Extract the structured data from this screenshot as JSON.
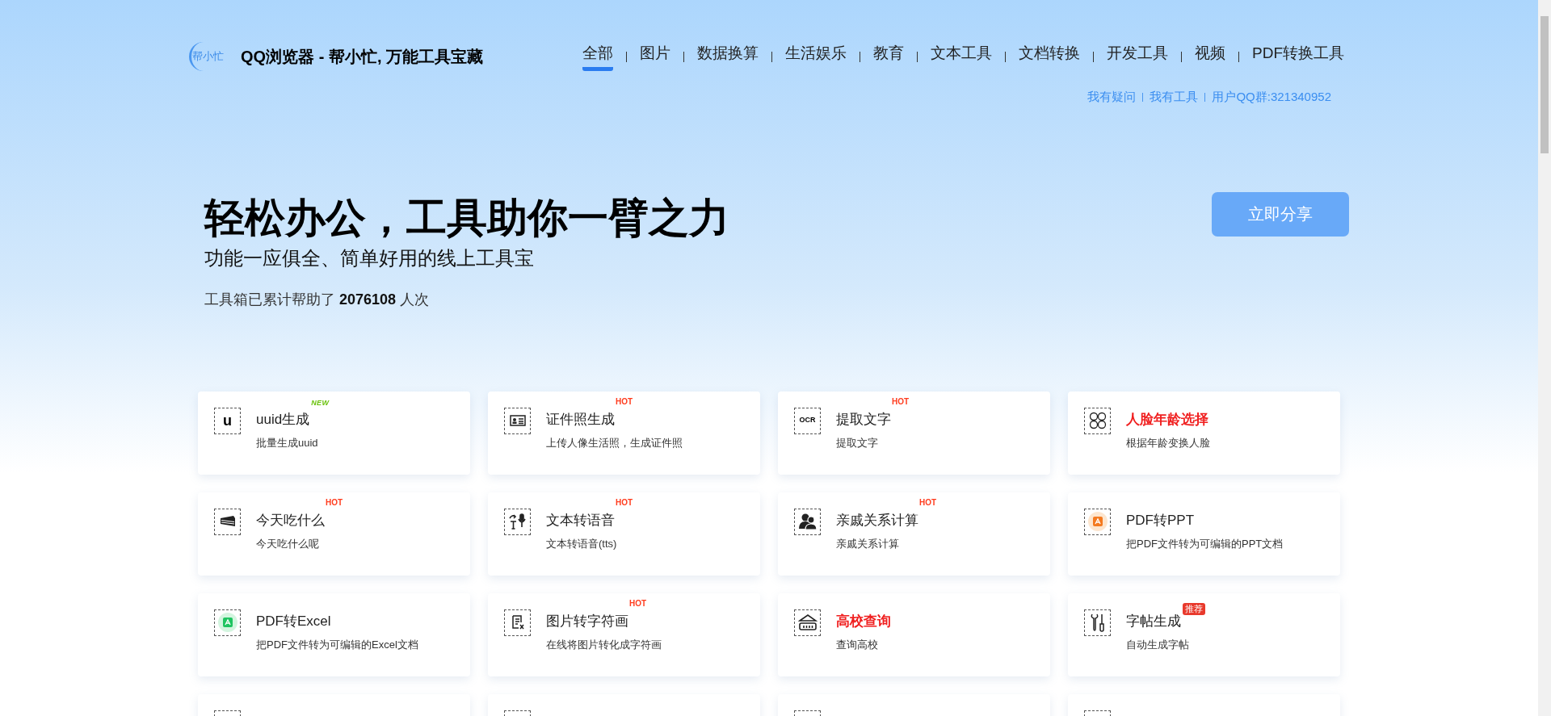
{
  "header": {
    "logo_text": "帮小忙",
    "title": "QQ浏览器 - 帮小忙, 万能工具宝藏",
    "nav": [
      {
        "label": "全部",
        "selected": true
      },
      {
        "label": "图片",
        "selected": false
      },
      {
        "label": "数据换算",
        "selected": false
      },
      {
        "label": "生活娱乐",
        "selected": false
      },
      {
        "label": "教育",
        "selected": false
      },
      {
        "label": "文本工具",
        "selected": false
      },
      {
        "label": "文档转换",
        "selected": false
      },
      {
        "label": "开发工具",
        "selected": false
      },
      {
        "label": "视频",
        "selected": false
      },
      {
        "label": "PDF转换工具",
        "selected": false
      }
    ],
    "links": [
      "我有疑问",
      "我有工具",
      "用户QQ群:321340952"
    ]
  },
  "hero": {
    "heading": "轻松办公，工具助你一臂之力",
    "subtitle": "功能一应俱全、简单好用的线上工具宝",
    "counter_prefix": "工具箱已累计帮助了",
    "counter_value": "2076108",
    "counter_suffix": "人次",
    "share_button": "立即分享"
  },
  "tools": [
    {
      "kind": "letter",
      "icon_text": "u",
      "title": "uuid生成",
      "highlight": false,
      "badge": {
        "kind": "new",
        "text": "NEW"
      },
      "description": "批量生成uuid"
    },
    {
      "kind": "id-card",
      "title": "证件照生成",
      "highlight": false,
      "badge": {
        "kind": "hot",
        "text": "HOT"
      },
      "description": "上传人像生活照，生成证件照"
    },
    {
      "kind": "letter",
      "icon_text": "OCR",
      "title": "提取文字",
      "highlight": false,
      "badge": {
        "kind": "hot",
        "text": "HOT"
      },
      "description": "提取文字"
    },
    {
      "kind": "faces",
      "title": "人脸年龄选择",
      "highlight": true,
      "description": "根据年龄变换人脸"
    },
    {
      "kind": "cake",
      "title": "今天吃什么",
      "highlight": false,
      "badge": {
        "kind": "hot",
        "text": "HOT"
      },
      "description": "今天吃什么呢"
    },
    {
      "kind": "speech",
      "title": "文本转语音",
      "highlight": false,
      "badge": {
        "kind": "hot",
        "text": "HOT"
      },
      "description": "文本转语音(tts)"
    },
    {
      "kind": "people",
      "title": "亲戚关系计算",
      "highlight": false,
      "badge": {
        "kind": "hot",
        "text": "HOT"
      },
      "description": "亲戚关系计算"
    },
    {
      "kind": "pdf-orange",
      "title": "PDF转PPT",
      "highlight": false,
      "description": "把PDF文件转为可编辑的PPT文档"
    },
    {
      "kind": "pdf-green",
      "title": "PDF转Excel",
      "highlight": false,
      "description": "把PDF文件转为可编辑的Excel文档"
    },
    {
      "kind": "document",
      "title": "图片转字符画",
      "highlight": false,
      "badge": {
        "kind": "hot",
        "text": "HOT"
      },
      "description": "在线将图片转化成字符画"
    },
    {
      "kind": "building",
      "title": "高校查询",
      "highlight": true,
      "description": "查询高校"
    },
    {
      "kind": "tools",
      "title": "字帖生成",
      "highlight": false,
      "badge": {
        "kind": "recommend",
        "text": "推荐"
      },
      "description": "自动生成字帖"
    }
  ]
}
